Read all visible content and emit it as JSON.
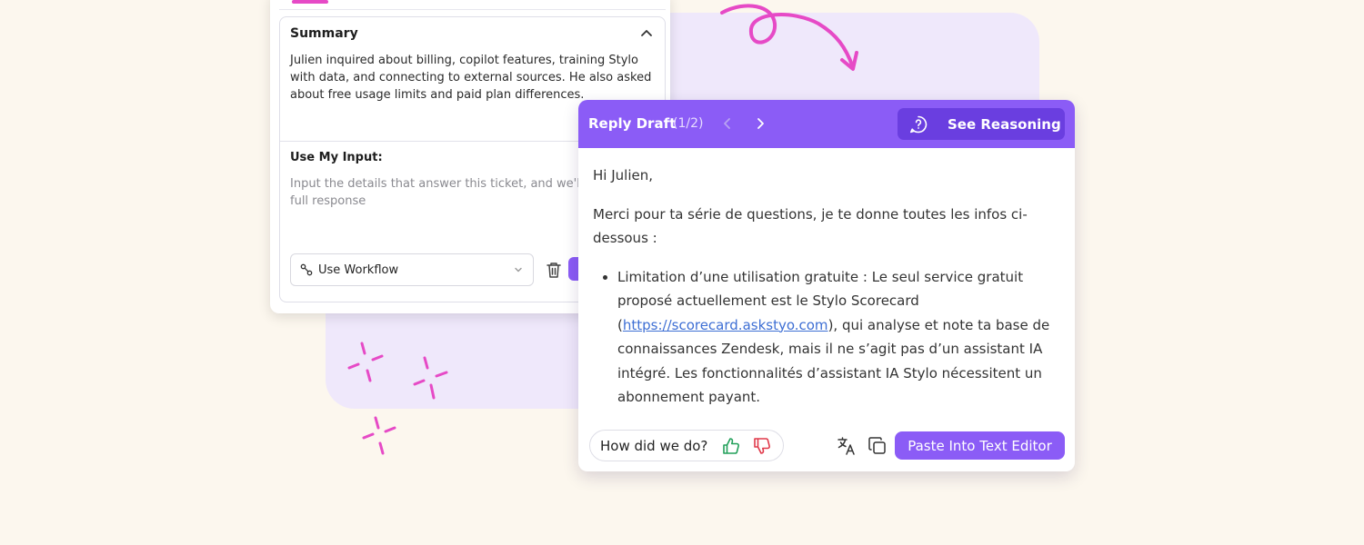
{
  "colors": {
    "background": "#fcf7ee",
    "blob": "#efe8fb",
    "accent_purple": "#8b5cf6",
    "accent_purple_dark": "#6a3ee0",
    "accent_pink": "#e64ac6",
    "link": "#3e6fd4",
    "thumb_up": "#22a05a",
    "thumb_down": "#e0394a"
  },
  "summary_card": {
    "summary_title": "Summary",
    "summary_text": "Julien inquired about billing, copilot features, training Stylo with data, and connecting to external sources. He also asked about free usage limits and paid plan differences.",
    "input_title": "Use My Input:",
    "input_placeholder": "Input the details that answer this ticket, and we'll",
    "input_placeholder_line2": "full response",
    "workflow_label": "Use Workflow",
    "icons": [
      "chevron-up-icon",
      "workflow-icon",
      "chevron-down-icon",
      "trash-icon"
    ]
  },
  "reply_draft": {
    "title": "Reply Draft",
    "count": "(1/2)",
    "see_reasoning_label": "See Reasoning",
    "greeting": "Hi Julien,",
    "intro": "Merci pour ta série de questions, je te donne toutes les infos ci-dessous :",
    "bullet_before_link": "Limitation d’une utilisation gratuite : Le seul service gratuit proposé actuellement est le Stylo Scorecard (",
    "bullet_link": "https://scorecard.askstyo.com",
    "bullet_after_link": "), qui analyse et note ta base de connaissances Zendesk, mais il ne s’agit pas d’un assistant IA intégré. Les fonctionnalités d’assistant IA Stylo nécessitent un abonnement payant.",
    "feedback_label": "How did we do?",
    "paste_label": "Paste Into Text Editor",
    "icons": [
      "chevron-left-icon",
      "chevron-right-icon",
      "reasoning-icon",
      "thumbs-up-icon",
      "thumbs-down-icon",
      "translate-icon",
      "copy-icon"
    ]
  }
}
